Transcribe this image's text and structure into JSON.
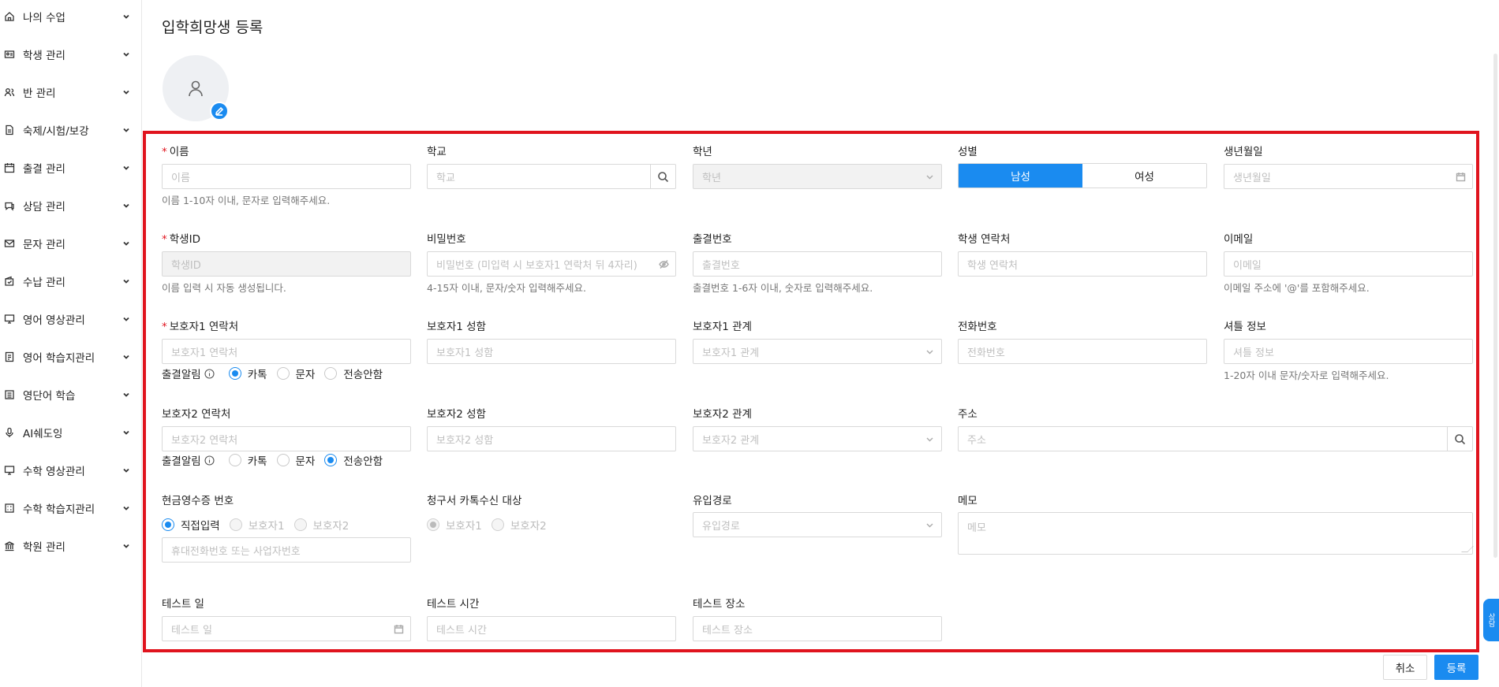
{
  "sidebar": {
    "items": [
      {
        "label": "나의 수업",
        "icon": "home-icon"
      },
      {
        "label": "학생 관리",
        "icon": "id-card-icon"
      },
      {
        "label": "반 관리",
        "icon": "users-icon"
      },
      {
        "label": "숙제/시험/보강",
        "icon": "document-icon"
      },
      {
        "label": "출결 관리",
        "icon": "calendar-icon"
      },
      {
        "label": "상담 관리",
        "icon": "chat-icon"
      },
      {
        "label": "문자 관리",
        "icon": "mail-icon"
      },
      {
        "label": "수납 관리",
        "icon": "wallet-icon"
      },
      {
        "label": "영어 영상관리",
        "icon": "monitor-icon"
      },
      {
        "label": "영어 학습지관리",
        "icon": "book-icon"
      },
      {
        "label": "영단어 학습",
        "icon": "card-icon"
      },
      {
        "label": "AI쉐도잉",
        "icon": "mic-icon"
      },
      {
        "label": "수학 영상관리",
        "icon": "monitor-icon"
      },
      {
        "label": "수학 학습지관리",
        "icon": "grid-icon"
      },
      {
        "label": "학원 관리",
        "icon": "bank-icon"
      }
    ]
  },
  "page": {
    "title": "입학희망생 등록"
  },
  "form": {
    "name": {
      "label": "이름",
      "placeholder": "이름",
      "help": "이름 1-10자 이내, 문자로 입력해주세요."
    },
    "school": {
      "label": "학교",
      "placeholder": "학교"
    },
    "grade": {
      "label": "학년",
      "placeholder": "학년"
    },
    "gender": {
      "label": "성별",
      "male": "남성",
      "female": "여성",
      "selected": "남성"
    },
    "birth": {
      "label": "생년월일",
      "placeholder": "생년월일"
    },
    "student_id": {
      "label": "학생ID",
      "placeholder": "학생ID",
      "help": "이름 입력 시 자동 생성됩니다."
    },
    "password": {
      "label": "비밀번호",
      "placeholder": "비밀번호 (미입력 시 보호자1 연락처 뒤 4자리)",
      "help": "4-15자 이내, 문자/숫자 입력해주세요."
    },
    "attendance_no": {
      "label": "출결번호",
      "placeholder": "출결번호",
      "help": "출결번호 1-6자 이내, 숫자로 입력해주세요."
    },
    "student_phone": {
      "label": "학생 연락처",
      "placeholder": "학생 연락처"
    },
    "email": {
      "label": "이메일",
      "placeholder": "이메일",
      "help": "이메일 주소에 '@'를 포함해주세요."
    },
    "guardian1_phone": {
      "label": "보호자1 연락처",
      "placeholder": "보호자1 연락처"
    },
    "guardian1_name": {
      "label": "보호자1 성함",
      "placeholder": "보호자1 성함"
    },
    "guardian1_relation": {
      "label": "보호자1 관계",
      "placeholder": "보호자1 관계"
    },
    "phone": {
      "label": "전화번호",
      "placeholder": "전화번호"
    },
    "shuttle": {
      "label": "셔틀 정보",
      "placeholder": "셔틀 정보",
      "help": "1-20자 이내 문자/숫자로 입력해주세요."
    },
    "guardian2_phone": {
      "label": "보호자2 연락처",
      "placeholder": "보호자2 연락처"
    },
    "guardian2_name": {
      "label": "보호자2 성함",
      "placeholder": "보호자2 성함"
    },
    "guardian2_relation": {
      "label": "보호자2 관계",
      "placeholder": "보호자2 관계"
    },
    "address": {
      "label": "주소",
      "placeholder": "주소"
    },
    "notify1": {
      "label": "출결알림",
      "options": [
        "카톡",
        "문자",
        "전송안함"
      ],
      "selected": "카톡"
    },
    "notify2": {
      "label": "출결알림",
      "options": [
        "카톡",
        "문자",
        "전송안함"
      ],
      "selected": "전송안함"
    },
    "cash_receipt": {
      "label": "현금영수증 번호",
      "options": [
        "직접입력",
        "보호자1",
        "보호자2"
      ],
      "selected": "직접입력",
      "placeholder": "휴대전화번호 또는 사업자번호"
    },
    "invoice_target": {
      "label": "청구서 카톡수신 대상",
      "options": [
        "보호자1",
        "보호자2"
      ],
      "selected": "보호자1"
    },
    "inflow": {
      "label": "유입경로",
      "placeholder": "유입경로"
    },
    "memo": {
      "label": "메모",
      "placeholder": "메모"
    },
    "test_date": {
      "label": "테스트 일",
      "placeholder": "테스트 일"
    },
    "test_time": {
      "label": "테스트 시간",
      "placeholder": "테스트 시간"
    },
    "test_place": {
      "label": "테스트 장소",
      "placeholder": "테스트 장소"
    }
  },
  "actions": {
    "cancel": "취소",
    "submit": "등록"
  },
  "side_tab": {
    "label": "상담"
  },
  "colors": {
    "accent": "#1a8bf0",
    "highlight": "#e0141e",
    "required": "#e0141e"
  }
}
